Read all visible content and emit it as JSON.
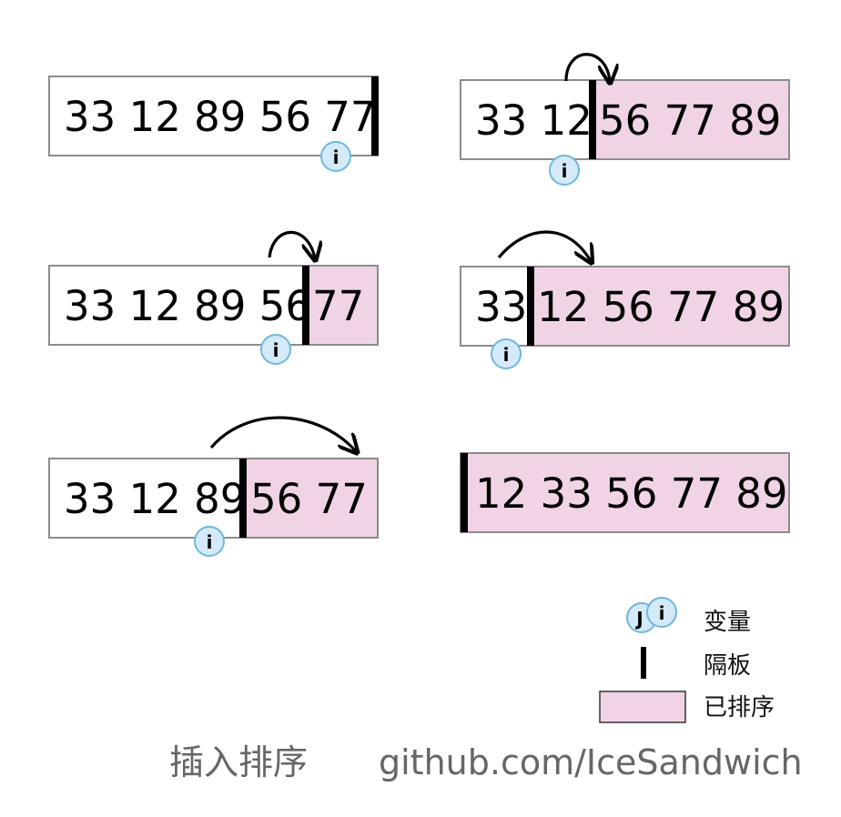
{
  "steps": [
    {
      "unsorted": "33 12 89 56 77",
      "sorted": ""
    },
    {
      "unsorted": "33 12 89 56",
      "sorted": "77"
    },
    {
      "unsorted": "33 12 89",
      "sorted": "56 77"
    },
    {
      "unsorted": "33 12",
      "sorted": "56 77 89"
    },
    {
      "unsorted": "33",
      "sorted": "12 56 77 89"
    },
    {
      "unsorted": "",
      "sorted": "12 33 56 77 89"
    }
  ],
  "variable_label": "i",
  "variable_j_label": "J",
  "legend": {
    "variable": "变量",
    "divider": "隔板",
    "sorted": "已排序"
  },
  "footer": {
    "title": "插入排序",
    "credit": "github.com/IceSandwich"
  },
  "colors": {
    "sorted_fill": "#f0d4e6",
    "box_border": "#8c8c8c",
    "divider": "#000000",
    "badge_fill": "#d4eaf8",
    "badge_stroke": "#6fb7e0",
    "footer_text": "#666666"
  }
}
